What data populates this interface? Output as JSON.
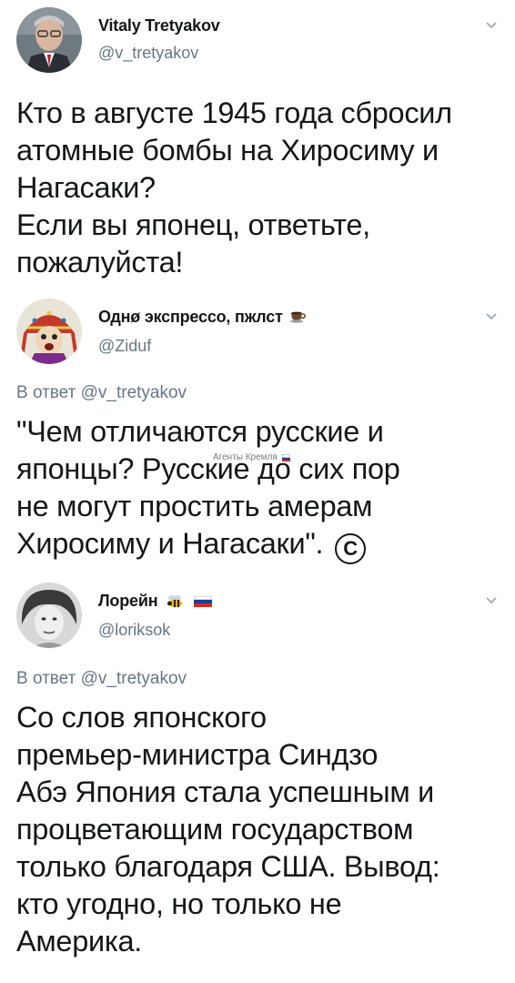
{
  "tweets": [
    {
      "name": "Vitaly Tretyakov",
      "handle": "@v_tretyakov",
      "avatar": "avatar-man-glasses",
      "lines": [
        "Кто в августе 1945 года сбросил",
        "атомные бомбы на Хиросиму и",
        "Нагасаки?",
        "Если вы японец, ответьте,",
        "пожалуйста!"
      ]
    },
    {
      "name": "Однø экспрессо, пжлст",
      "name_icon": "coffee-cup-icon",
      "handle": "@Ziduf",
      "avatar": "avatar-costume-character",
      "reply_prefix": "В ответ",
      "reply_handle": "@v_tretyakov",
      "watermark": "Агенты Кремля",
      "lines": [
        "\"Чем отличаются русские и",
        "японцы? Русские до сих пор",
        "не могут простить амерам",
        "Хиросиму и Нагасаки\"."
      ],
      "trailing_icon": "copyright-icon",
      "trailing_glyph": "C"
    },
    {
      "name": "Лорейн",
      "name_icons": [
        "bee-icon",
        "russian-flag-icon"
      ],
      "handle": "@loriksok",
      "avatar": "avatar-woman-bw",
      "reply_prefix": "В ответ",
      "reply_handle": "@v_tretyakov",
      "lines": [
        "Со слов японского",
        "премьер-министра Синдзо",
        "Абэ  Япония стала успешным и",
        "процветающим государством",
        "только благодаря США. Вывод:",
        "кто угодно, но только не",
        "Америка."
      ]
    }
  ],
  "colors": {
    "text": "#14171a",
    "secondary": "#657786",
    "flag_white": "#ffffff",
    "flag_blue": "#1c3f94",
    "flag_red": "#d52b1e"
  }
}
